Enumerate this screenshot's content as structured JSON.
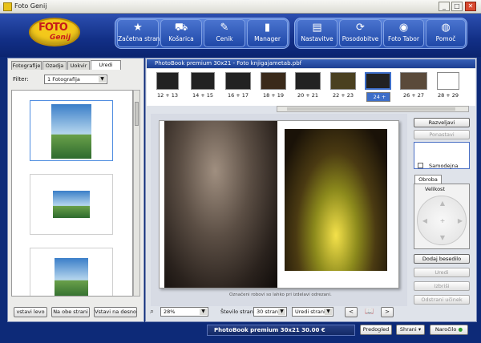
{
  "window": {
    "title": "Foto Genij",
    "controls": [
      "_",
      "□",
      "✕"
    ]
  },
  "logo": {
    "line1": "FOTO",
    "line2": "Genij"
  },
  "nav": [
    {
      "label": "Začetna stran",
      "icon": "star-icon"
    },
    {
      "label": "Košarica",
      "icon": "cart-icon"
    },
    {
      "label": "Cenik",
      "icon": "price-tags-icon"
    },
    {
      "label": "Manager",
      "icon": "trash-icon"
    },
    {
      "label": "Nastavitve",
      "icon": "settings-icon"
    },
    {
      "label": "Posodobitve",
      "icon": "update-icon"
    },
    {
      "label": "Foto Tabor",
      "icon": "globe-icon"
    },
    {
      "label": "Pomoč",
      "icon": "help-icon"
    }
  ],
  "left": {
    "tabs": [
      "Fotografije",
      "Ozadja",
      "Uokvir",
      "Uredi"
    ],
    "filter_label": "Filter:",
    "filter_value": "1 Fotografija",
    "buttons": [
      "vstavi levo",
      "Na obe strani",
      "Vstavi na desno"
    ]
  },
  "project_title": "PhotoBook premium 30x21 - Foto knjigajametab.pbf",
  "spreads": [
    "12 + 13",
    "14 + 15",
    "16 + 17",
    "18 + 19",
    "20 + 21",
    "22 + 23",
    "24 + 25",
    "26 + 27",
    "28 + 29"
  ],
  "selected_spread": "24 + 25",
  "hint": "Označeni robovi so lahko pri izdelavi odrezani.",
  "right_buttons": {
    "razveljavi": "Razveljavi",
    "ponastavi": "Ponastavi",
    "samodejna": "Samodejna",
    "obroba_tab": "Obroba",
    "velikost": "Velikost",
    "dodaj_besedilo": "Dodaj besedilo",
    "uredi": "Uredi",
    "izbrisi": "Izbriši",
    "odstrani_ucinek": "Odstrani učinek"
  },
  "bottom": {
    "zoom": "28%",
    "stevilo_label": "Število strani:",
    "stevilo_value": "30 strani",
    "uredi_strani": "Uredi strani",
    "prev": "<",
    "next": ">"
  },
  "footer": {
    "price": "PhotoBook premium 30x21 30.00 €",
    "predogled": "Predogled",
    "shrani": "Shrani",
    "naroclo": "Naročilo"
  },
  "colors": {
    "header_blue": "#122f86",
    "logo_yellow": "#f3c81b",
    "selected_blue": "#3d6ec9"
  }
}
